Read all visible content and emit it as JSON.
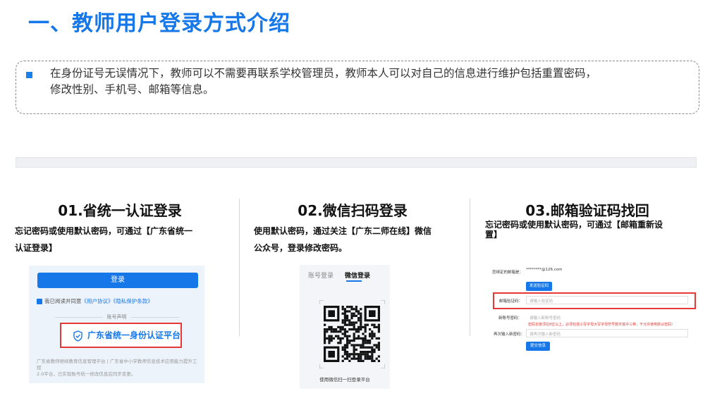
{
  "title": "一、教师用户登录方式介绍",
  "intro": {
    "line1": "在身份证号无误情况下，教师可以不需要再联系学校管理员，教师本人可以对自己的信息进行维护包括重置密码，",
    "line2": "修改性别、手机号、邮箱等信息。"
  },
  "sections": [
    {
      "heading": "01.省统一认证登录",
      "desc_line1": "忘记密码或使用默认密码，可通过【广东省统一",
      "desc_line2": "认证登录】"
    },
    {
      "heading": "02.微信扫码登录",
      "desc_line1": "使用默认密码，通过关注【广东二师在线】微信",
      "desc_line2": "公众号，登录修改密码。"
    },
    {
      "heading": "03.邮箱验证码找回",
      "desc_line1": "忘记密码或使用默认密码，可通过【邮箱重新设",
      "desc_line2": "置】"
    }
  ],
  "panel1": {
    "login_button": "登录",
    "agree_prefix": "我已阅读并同意",
    "agree_link1": "《用户协议》",
    "agree_link2": "《隐私保护条款》",
    "account_statement": "账号声明",
    "id_platform_button": "广东省统一身份认证平台",
    "footer_line1": "广东省教师继续教育信息管理平台 | 广东省中小学教师信息技术应用能力提升工程",
    "footer_line2": "2.0平台，已实现账号统一修改信息后同步变更。"
  },
  "panel2": {
    "tab_account": "账号登录",
    "tab_wechat": "微信登录",
    "qr_caption": "使用微信扫一扫登录平台"
  },
  "panel3": {
    "email_label": "您绑定的邮箱是：",
    "email_value": "********@126.com",
    "send_code_button": "发送验证码",
    "code_label": "邮箱验证码：",
    "code_placeholder": "请输入验证码",
    "new_pwd_label": "新账号密码：",
    "new_pwd_placeholder": "请输入新账号密码",
    "pwd_rule": "密码长度须在8位以上，必须包括小写字母大写字母符号数字其中三种，不允许使用默认密码!",
    "confirm_label": "再次输入新密码：",
    "confirm_placeholder": "请再次输入新密码",
    "submit_button": "提交信息"
  },
  "colors": {
    "accent": "#1677e8",
    "highlight_red": "#e53935"
  }
}
